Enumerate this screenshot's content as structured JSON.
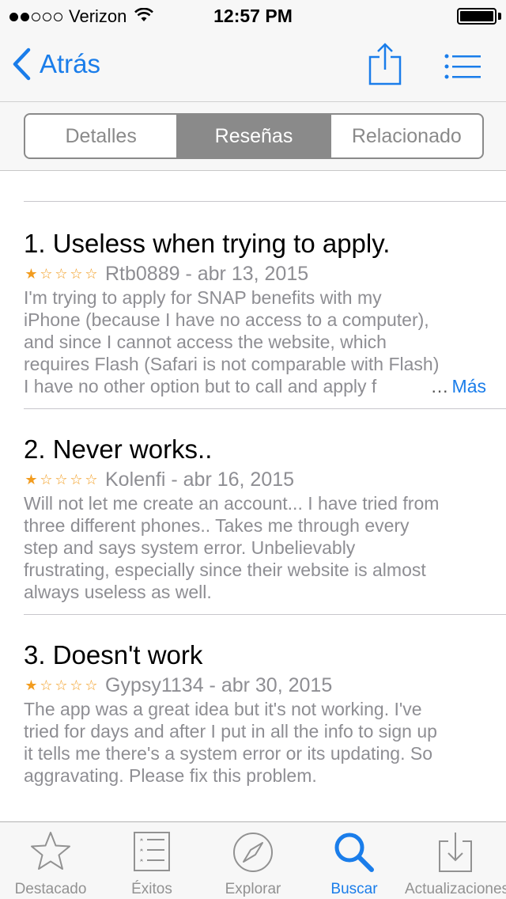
{
  "status_bar": {
    "carrier": "Verizon",
    "time": "12:57 PM",
    "signal_bars_filled": 2,
    "signal_bars_total": 5
  },
  "nav": {
    "back_label": "Atrás",
    "share_icon": "share-icon",
    "list_icon": "list-icon"
  },
  "segments": [
    {
      "label": "Detalles",
      "active": false
    },
    {
      "label": "Reseñas",
      "active": true
    },
    {
      "label": "Relacionado",
      "active": false
    }
  ],
  "reviews": [
    {
      "title": "1. Useless when trying to apply.",
      "rating": 1,
      "meta": "Rtb0889 - abr 13, 2015",
      "lines": [
        "I'm trying to apply for SNAP benefits with my",
        "iPhone (because I have no access to a computer),",
        "and since I cannot access the website, which",
        "requires Flash (Safari is not comparable with Flash)",
        "I have no other option but to call and apply f"
      ],
      "ellipsis": "…",
      "more_label": "Más"
    },
    {
      "title": "2. Never works..",
      "rating": 1,
      "meta": "Kolenfi - abr 16, 2015",
      "lines": [
        "Will not let me create an account... I have tried from",
        "three different phones.. Takes me through every",
        "step and says system error. Unbelievably",
        "frustrating, especially since their website is almost",
        "always useless as well."
      ]
    },
    {
      "title": "3. Doesn't work",
      "rating": 1,
      "meta": "Gypsy1134 - abr 30, 2015",
      "lines": [
        "The app was a great idea but it's not working. I've",
        "tried for days and after I put in all the info to sign up",
        "it tells me there's a system error or its updating. So",
        "aggravating. Please fix this problem."
      ]
    }
  ],
  "tabs": [
    {
      "label": "Destacado",
      "icon": "star-icon",
      "active": false
    },
    {
      "label": "Éxitos",
      "icon": "top-charts-icon",
      "active": false
    },
    {
      "label": "Explorar",
      "icon": "compass-icon",
      "active": false
    },
    {
      "label": "Buscar",
      "icon": "search-icon",
      "active": true
    },
    {
      "label": "Actualizaciones",
      "icon": "updates-icon",
      "active": false
    }
  ],
  "colors": {
    "accent": "#1a7dea",
    "star": "#f29c1f",
    "secondary_text": "#8e8e93",
    "segment_active": "#8a8a8a"
  }
}
